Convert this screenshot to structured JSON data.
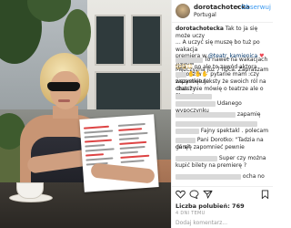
{
  "post": {
    "username": "dorotachotecka",
    "dot": "•",
    "follow_label": "Obserwuj",
    "location": "Portugal"
  },
  "caption": {
    "author": "dorotachotecka",
    "text": "Tak to ja się może uczy",
    "lines": [
      "... A uczyć się muszę bo tuż po wakacja",
      "premiera w",
      "Mężczyzna juz 7 lipca. Zapraszam"
    ],
    "mention": "@teatr_kamienica",
    "mention_suffix": "Tresow"
  },
  "comments": [
    {
      "text": "To nawet na wakacjach trza"
    },
    {
      "text": "no ale to zawód aktora ....podziw"
    },
    {
      "text": "pytanie mam :czy zapamiętuje"
    },
    {
      "text": "wszystkie teksty że swoich ról na dłuższy"
    },
    {
      "text": "czas ? nie mówię o teatrze ale o filmach"
    },
    {
      "text": "Udanego wypoczynku"
    },
    {
      "text": "zapamię"
    },
    {
      "text": "Fajny spektakl . polecam"
    },
    {
      "text": "Pani Dorotko: \"Tadzia na górę\""
    },
    {
      "text": "da się zapomnieć pewnie"
    },
    {
      "text": "Super czy można"
    },
    {
      "text": "kupić bilety na premierę ?"
    },
    {
      "text": "ocha no"
    }
  ],
  "footer": {
    "likes": "Liczba polubień: 769",
    "date": "4 DNI TEMU",
    "add_comment_placeholder": "Dodaj komentarz..."
  },
  "colors": {
    "link_blue": "#3897f0",
    "text_dark": "#262626",
    "muted": "#999999",
    "heart_red": "#ed4956"
  },
  "icons": [
    "heart-icon",
    "comment-icon",
    "share-icon",
    "bookmark-icon"
  ]
}
